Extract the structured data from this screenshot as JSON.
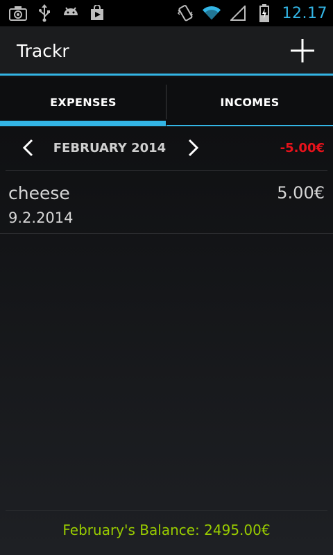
{
  "status_bar": {
    "time": "12.17",
    "left_icons": [
      "camera-icon",
      "usb-icon",
      "android-debug-icon",
      "play-store-icon"
    ],
    "right_icons": [
      "vibrate-icon",
      "wifi-icon",
      "signal-icon",
      "battery-charging-icon"
    ]
  },
  "action_bar": {
    "title": "Trackr",
    "add_icon": "plus-icon"
  },
  "tabs": [
    {
      "label": "EXPENSES",
      "selected": true
    },
    {
      "label": "INCOMES",
      "selected": false
    }
  ],
  "month_nav": {
    "month": "FEBRUARY 2014",
    "total": "-5.00€"
  },
  "entries": [
    {
      "name": "cheese",
      "amount": "5.00€",
      "date": "9.2.2014"
    }
  ],
  "footer": {
    "balance": "February's Balance: 2495.00€"
  },
  "colors": {
    "accent": "#33b5e5",
    "negative": "#e8121b",
    "balance": "#99cc00"
  }
}
